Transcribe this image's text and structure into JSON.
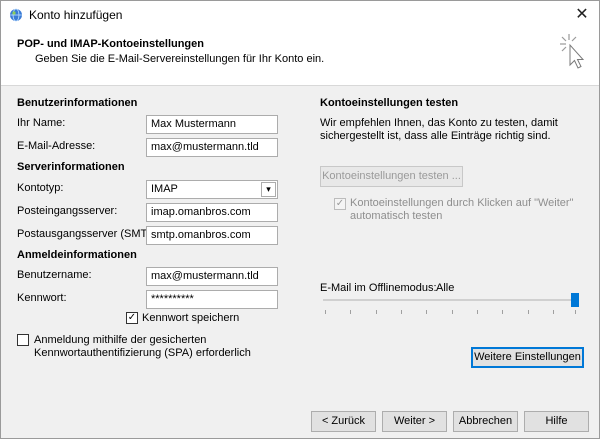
{
  "window": {
    "title": "Konto hinzufügen",
    "close_glyph": "✕"
  },
  "header": {
    "title": "POP- und IMAP-Kontoeinstellungen",
    "subtitle": "Geben Sie die E-Mail-Servereinstellungen für Ihr Konto ein."
  },
  "user_info": {
    "section_title": "Benutzerinformationen",
    "name_label": "Ihr Name:",
    "name_value": "Max Mustermann",
    "email_label": "E-Mail-Adresse:",
    "email_value": "max@mustermann.tld"
  },
  "server_info": {
    "section_title": "Serverinformationen",
    "account_type_label": "Kontotyp:",
    "account_type_value": "IMAP",
    "incoming_label": "Posteingangsserver:",
    "incoming_value": "imap.omanbros.com",
    "outgoing_label": "Postausgangsserver (SMTP):",
    "outgoing_value": "smtp.omanbros.com"
  },
  "login_info": {
    "section_title": "Anmeldeinformationen",
    "username_label": "Benutzername:",
    "username_value": "max@mustermann.tld",
    "password_label": "Kennwort:",
    "password_value": "**********",
    "remember_password_label": "Kennwort speichern",
    "remember_password_checked": true,
    "spa_label_line1": "Anmeldung mithilfe der gesicherten",
    "spa_label_line2": "Kennwortauthentifizierung (SPA) erforderlich",
    "spa_checked": false
  },
  "test_settings": {
    "section_title": "Kontoeinstellungen testen",
    "description_line1": "Wir empfehlen Ihnen, das Konto zu testen, damit",
    "description_line2": "sichergestellt ist, dass alle Einträge richtig sind.",
    "test_button": "Kontoeinstellungen testen ...",
    "auto_test_line1": "Kontoeinstellungen durch Klicken auf \"Weiter\"",
    "auto_test_line2": "automatisch testen",
    "auto_test_checked": true
  },
  "offline": {
    "label": "E-Mail im Offlinemodus:",
    "value": "Alle"
  },
  "more_settings_button": "Weitere Einstellungen",
  "footer": {
    "back": "< Zurück",
    "next": "Weiter >",
    "cancel": "Abbrechen",
    "help": "Hilfe"
  },
  "colors": {
    "accent": "#0078d7",
    "background": "#f0f0f0"
  },
  "icons": {
    "app": "outlook-globe-icon",
    "header": "cursor-sparkle-icon"
  }
}
